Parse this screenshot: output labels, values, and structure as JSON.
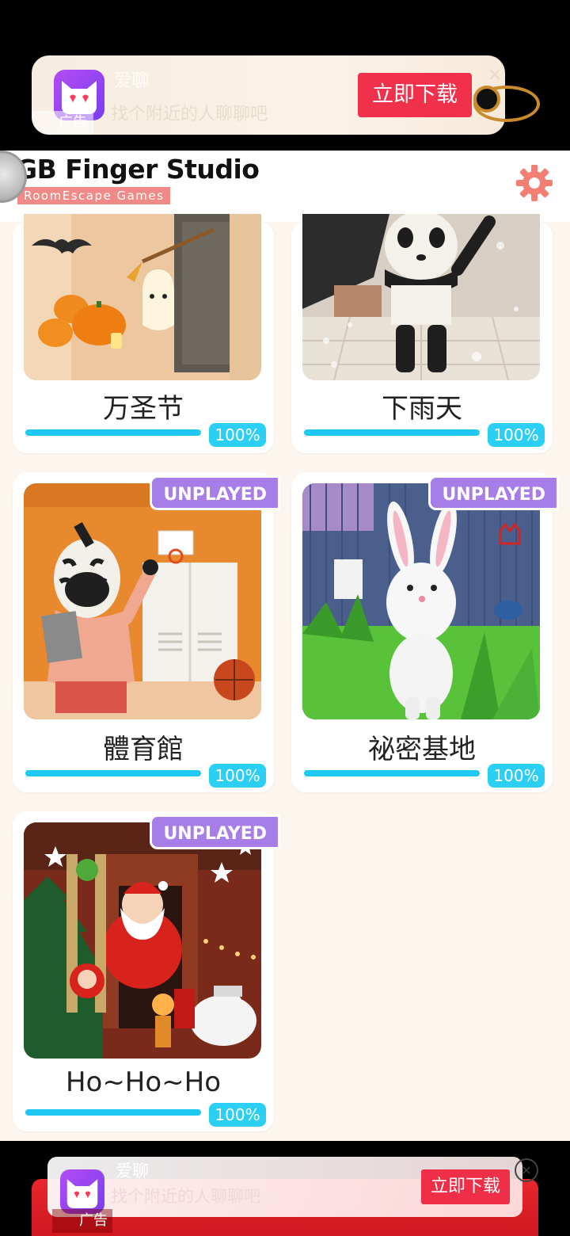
{
  "top_ad": {
    "app_name": "爱聊",
    "description": "找个附近的人聊聊吧",
    "download_label": "立即下载",
    "ad_tag": "广告",
    "close_icon": "×"
  },
  "header": {
    "title": "GB Finger Studio",
    "subtitle": "RoomEscape  Games",
    "settings_icon": "gear-icon",
    "accent_color": "#f37f73"
  },
  "levels": [
    {
      "title": "万圣节",
      "progress": "100%",
      "progress_value": 1.0,
      "unplayed": false,
      "theme": "halloween"
    },
    {
      "title": "下雨天",
      "progress": "100%",
      "progress_value": 1.0,
      "unplayed": false,
      "theme": "rainy"
    },
    {
      "title": "體育館",
      "progress": "100%",
      "progress_value": 1.0,
      "unplayed": true,
      "theme": "gym"
    },
    {
      "title": "祕密基地",
      "progress": "100%",
      "progress_value": 1.0,
      "unplayed": true,
      "theme": "base"
    },
    {
      "title": "Ho~Ho~Ho",
      "progress": "100%",
      "progress_value": 1.0,
      "unplayed": true,
      "theme": "christmas"
    }
  ],
  "unplayed_label": "UNPLAYED",
  "bottom_ad": {
    "app_name": "爱聊",
    "description": "找个附近的人聊聊吧",
    "download_label": "立即下载",
    "ad_tag": "广告",
    "close_icon": "×"
  },
  "colors": {
    "progress": "#1ec8f0",
    "badge": "#a77ee8",
    "download": "#f1304b"
  }
}
